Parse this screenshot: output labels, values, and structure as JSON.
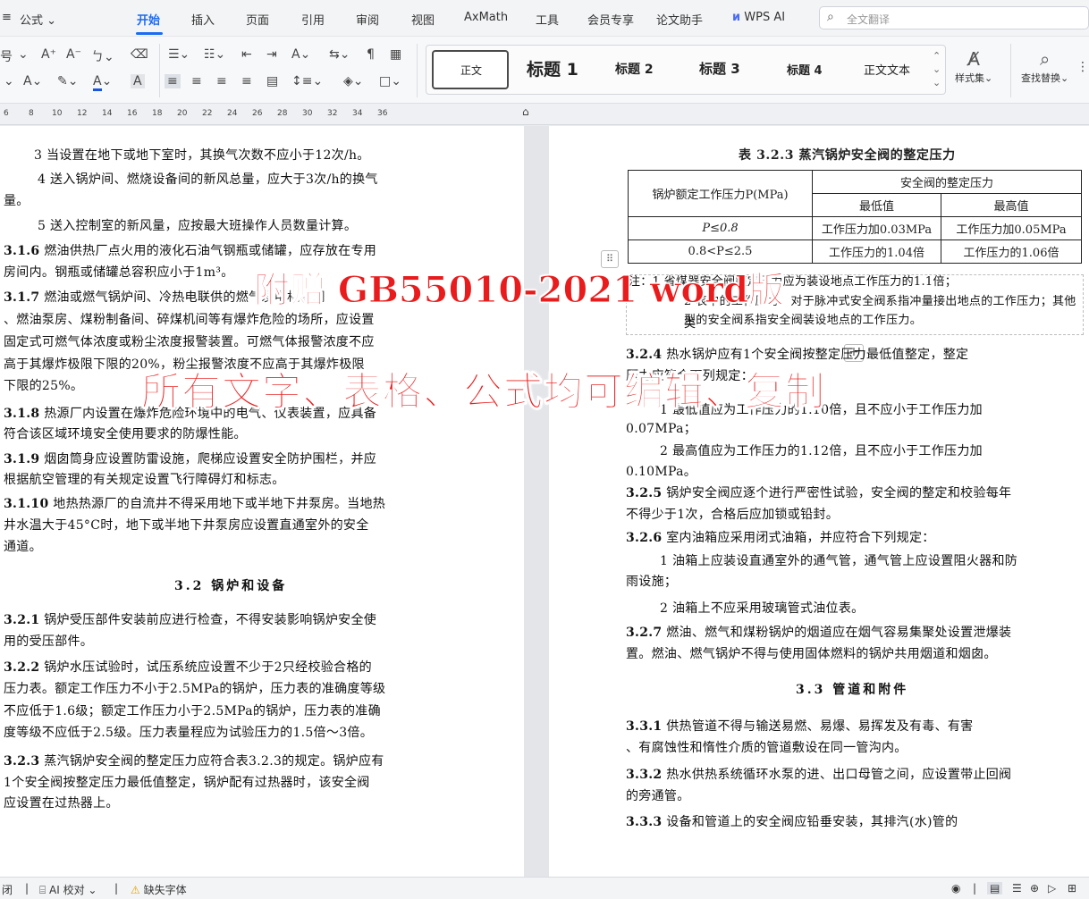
{
  "menubar": {
    "left_partial": "≡",
    "formula_dropdown": "公式",
    "tabs": [
      "开始",
      "插入",
      "页面",
      "引用",
      "审阅",
      "视图",
      "AxMath",
      "工具",
      "会员专享",
      "论文助手"
    ],
    "wps_ai": "WPS AI",
    "search_placeholder": "全文翻译"
  },
  "ribbon": {
    "font_partial": "号",
    "styles": [
      "正文",
      "标题 1",
      "标题 2",
      "标题 3",
      "标题 4",
      "正文文本"
    ],
    "styles_set_label": "样式集",
    "find_replace_label": "查找替换"
  },
  "ruler": {
    "ticks": [
      "6",
      "8",
      "10",
      "12",
      "14",
      "16",
      "18",
      "20",
      "22",
      "24",
      "26",
      "28",
      "30",
      "32",
      "34",
      "36"
    ]
  },
  "left_page": {
    "lines": [
      {
        "t": "3 当设置在地下或地下室时，其换气次数不应小于12次/h。"
      },
      {
        "t": "4 送入锅炉间、燃烧设备间的新风总量，应大于3次/h的换气"
      },
      {
        "t": "量。"
      },
      {
        "t": "5 送入控制室的新风量，应按最大班操作人员数量计算。"
      },
      {
        "n": "3.1.6",
        "t": "燃油供热厂点火用的液化石油气钢瓶或储罐，应存放在专用"
      },
      {
        "t": "房间内。钢瓶或储罐总容积应小于1m³。"
      },
      {
        "n": "3.1.7",
        "t": "燃油或燃气锅炉间、冷热电联供的燃气发电机组间"
      },
      {
        "t": "、燃油泵房、煤粉制备间、碎煤机间等有爆炸危险的场所，应设置"
      },
      {
        "t": "固定式可燃气体浓度或粉尘浓度报警装置。可燃气体报警浓度不应"
      },
      {
        "t": "高于其爆炸极限下限的20%，粉尘报警浓度不应高于其爆炸极限"
      },
      {
        "t": "下限的25%。"
      },
      {
        "n": "3.1.8",
        "t": "热源厂内设置在爆炸危险环境中的电气、仪表装置，应具备"
      },
      {
        "t": "符合该区域环境安全使用要求的防爆性能。"
      },
      {
        "n": "3.1.9",
        "t": "烟囱筒身应设置防雷设施，爬梯应设置安全防护围栏，并应"
      },
      {
        "t": "根据航空管理的有关规定设置飞行障碍灯和标志。"
      },
      {
        "n": "3.1.10",
        "t": "地热热源厂的自流井不得采用地下或半地下井泵房。当地热"
      },
      {
        "t": "井水温大于45°C时，地下或半地下井泵房应设置直通室外的安全"
      },
      {
        "t": "通道。"
      },
      {
        "n": "3.2.1",
        "t": "锅炉受压部件安装前应进行检查，不得安装影响锅炉安全使"
      },
      {
        "t": "用的受压部件。"
      },
      {
        "n": "3.2.2",
        "t": "锅炉水压试验时，试压系统应设置不少于2只经校验合格的"
      },
      {
        "t": "压力表。额定工作压力不小于2.5MPa的锅炉，压力表的准确度等级"
      },
      {
        "t": "不应低于1.6级；额定工作压力小于2.5MPa的锅炉，压力表的准确"
      },
      {
        "t": "度等级不应低于2.5级。压力表量程应为试验压力的1.5倍～3倍。"
      },
      {
        "n": "3.2.3",
        "t": "蒸汽锅炉安全阀的整定压力应符合表3.2.3的规定。锅炉应有"
      },
      {
        "t": "1个安全阀按整定压力最低值整定，锅炉配有过热器时，该安全阀"
      },
      {
        "t": "应设置在过热器上。"
      }
    ],
    "heading_32": "3.2 锅炉和设备"
  },
  "right_page": {
    "table_caption": "表 3.2.3 蒸汽锅炉安全阀的整定压力",
    "table": {
      "h_col1": "锅炉额定工作压力P(MPa)",
      "h_group": "安全阀的整定压力",
      "h_min": "最低值",
      "h_max": "最高值",
      "rows": [
        [
          "P≤0.8",
          "工作压力加0.03MPa",
          "工作压力加0.05MPa"
        ],
        [
          "0.8<P≤2.5",
          "工作压力的1.04倍",
          "工作压力的1.06倍"
        ]
      ]
    },
    "note_lines": [
      "注：1 省煤器安全阀整定压力应为装设地点工作压力的1.1倍；",
      "2 表中的工作压力，对于脉冲式安全阀系指冲量接出地点的工作压力；其他类",
      "型的安全阀系指安全阀装设地点的工作压力。"
    ],
    "lines": [
      {
        "n": "3.2.4",
        "t": "热水锅炉应有1个安全阀按整定压力最低值整定，整定"
      },
      {
        "t": "压力应符合下列规定："
      },
      {
        "t": "1 最低值应为工作压力的1.10倍，且不应小于工作压力加"
      },
      {
        "t": "0.07MPa；"
      },
      {
        "t": "2 最高值应为工作压力的1.12倍，且不应小于工作压力加"
      },
      {
        "t": "0.10MPa。"
      },
      {
        "n": "3.2.5",
        "t": "锅炉安全阀应逐个进行严密性试验，安全阀的整定和校验每年"
      },
      {
        "t": "不得少于1次，合格后应加锁或铅封。"
      },
      {
        "n": "3.2.6",
        "t": "室内油箱应采用闭式油箱，并应符合下列规定："
      },
      {
        "t": "1 油箱上应装设直通室外的通气管，通气管上应设置阻火器和防"
      },
      {
        "t": "雨设施；"
      },
      {
        "t": "2 油箱上不应采用玻璃管式油位表。"
      },
      {
        "n": "3.2.7",
        "t": "燃油、燃气和煤粉锅炉的烟道应在烟气容易集聚处设置泄爆装"
      },
      {
        "t": "置。燃油、燃气锅炉不得与使用固体燃料的锅炉共用烟道和烟囱。"
      },
      {
        "n": "3.3.1",
        "t": "供热管道不得与输送易燃、易爆、易挥发及有毒、有害"
      },
      {
        "t": "、有腐蚀性和惰性介质的管道敷设在同一管沟内。"
      },
      {
        "n": "3.3.2",
        "t": "热水供热系统循环水泵的进、出口母管之间，应设置带止回阀"
      },
      {
        "t": "的旁通管。"
      },
      {
        "n": "3.3.3",
        "t": "设备和管道上的安全阀应铅垂安装，其排汽(水)管的"
      }
    ],
    "heading_33": "3.3 管道和附件"
  },
  "watermark": {
    "line1": "附赠 GB55010-2021 word版",
    "line2": "所有文字、表格、公式均可编辑、复制"
  },
  "statusbar": {
    "left_partial": "闭",
    "ai_check": "AI 校对",
    "missing_fonts": "缺失字体"
  },
  "colors": {
    "accent": "#1c6cf0",
    "watermark": "#e81c1c"
  }
}
